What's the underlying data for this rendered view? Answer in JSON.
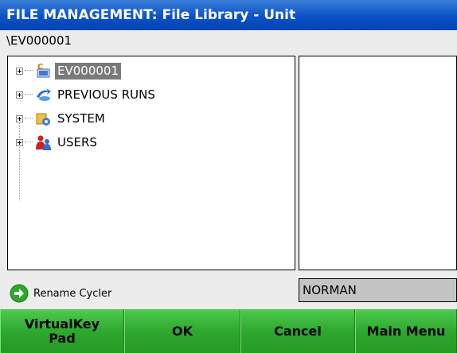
{
  "title": "FILE MANAGEMENT: File Library - Unit",
  "path": "\\EV000001",
  "tree": [
    {
      "label": "EV000001",
      "icon": "unit-icon",
      "selected": true
    },
    {
      "label": "PREVIOUS RUNS",
      "icon": "previous-runs-icon",
      "selected": false
    },
    {
      "label": "SYSTEM",
      "icon": "system-icon",
      "selected": false
    },
    {
      "label": "USERS",
      "icon": "users-icon",
      "selected": false
    }
  ],
  "action": {
    "label": "Rename Cycler",
    "icon": "green-arrow-icon"
  },
  "name_field": {
    "value": "NORMAN"
  },
  "buttons": {
    "virtualkey": "VirtualKey\nPad",
    "ok": "OK",
    "cancel": "Cancel",
    "main_menu": "Main Menu"
  },
  "colors": {
    "title_bar": "#0a52c8",
    "button": "#2ea82e",
    "selection": "#7a7a7a"
  }
}
